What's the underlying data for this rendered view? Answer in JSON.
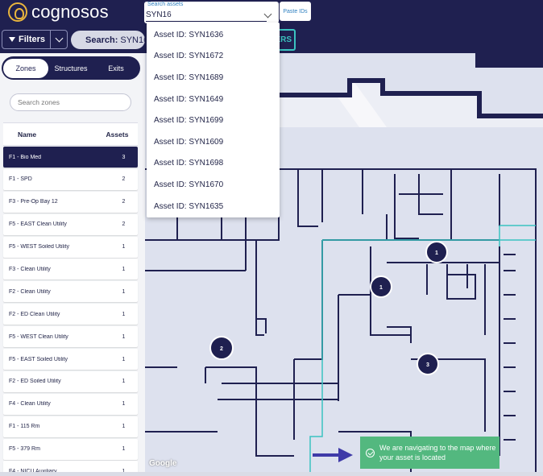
{
  "app": {
    "logo_text": "cognosos"
  },
  "colors": {
    "navy": "#1f2050",
    "accent_teal": "#3bc3c0",
    "toast_green": "#53b87f",
    "link_blue": "#2f80c0"
  },
  "toolbar": {
    "filters_label": "Filters",
    "search_chip": {
      "label": "Search:",
      "value": "SYN16"
    },
    "filters_tail_text": "ERS"
  },
  "asset_search": {
    "label": "Search assets",
    "value": "SYN16",
    "paste_label": "Paste IDs",
    "results": [
      "Asset ID: SYN1636",
      "Asset ID: SYN1672",
      "Asset ID: SYN1689",
      "Asset ID: SYN1649",
      "Asset ID: SYN1699",
      "Asset ID: SYN1609",
      "Asset ID: SYN1698",
      "Asset ID: SYN1670",
      "Asset ID: SYN1635"
    ]
  },
  "panel": {
    "tabs": [
      "Zones",
      "Structures",
      "Exits"
    ],
    "active_tab": "Zones",
    "zone_search_placeholder": "Search zones",
    "columns": {
      "name": "Name",
      "assets": "Assets"
    },
    "rows": [
      {
        "name": "F1 - Bio Med",
        "assets": "3",
        "selected": true
      },
      {
        "name": "F1 - SPD",
        "assets": "2"
      },
      {
        "name": "F3 - Pre-Op Bay 12",
        "assets": "2"
      },
      {
        "name": "F5 - EAST Clean Utility",
        "assets": "2"
      },
      {
        "name": "F5 - WEST Soiled Utility",
        "assets": "1"
      },
      {
        "name": "F3 - Clean Utility",
        "assets": "1"
      },
      {
        "name": "F2 - Clean Utility",
        "assets": "1"
      },
      {
        "name": "F2 - ED Clean Utility",
        "assets": "1"
      },
      {
        "name": "F5 - WEST Clean Utility",
        "assets": "1"
      },
      {
        "name": "F5 - EAST Soiled Utility",
        "assets": "1"
      },
      {
        "name": "F2 - ED Soiled Utility",
        "assets": "1"
      },
      {
        "name": "F4 - Clean Utility",
        "assets": "1"
      },
      {
        "name": "F1 - 115 Rm",
        "assets": "1"
      },
      {
        "name": "F5 - 379 Rm",
        "assets": "1"
      },
      {
        "name": "F4 - NICU Auxiliary",
        "assets": "1"
      }
    ]
  },
  "map": {
    "markers": [
      {
        "label": "1"
      },
      {
        "label": "1"
      },
      {
        "label": "2"
      },
      {
        "label": "3"
      }
    ],
    "attribution": "Google"
  },
  "toast": {
    "message": "We are navigating to the map where your asset is located"
  }
}
